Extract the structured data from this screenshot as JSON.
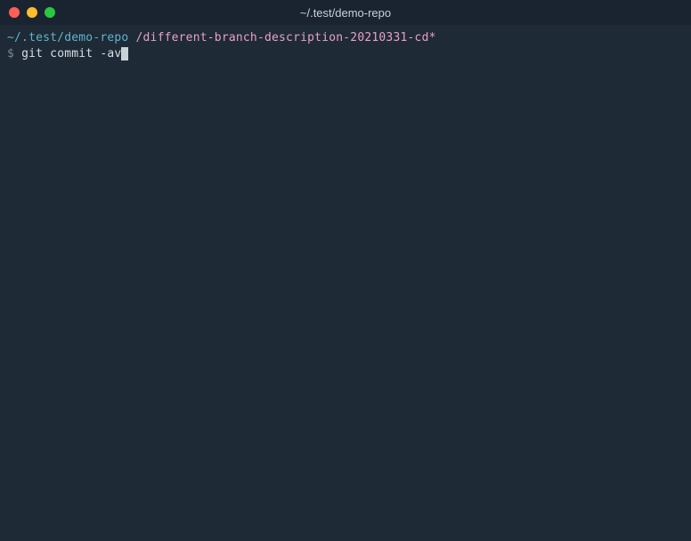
{
  "window": {
    "title": "~/.test/demo-repo"
  },
  "prompt": {
    "path": "~/.test/demo-repo",
    "branch": "/different-branch-description-20210331-cd*",
    "symbol": "$",
    "command": "git commit -av"
  }
}
